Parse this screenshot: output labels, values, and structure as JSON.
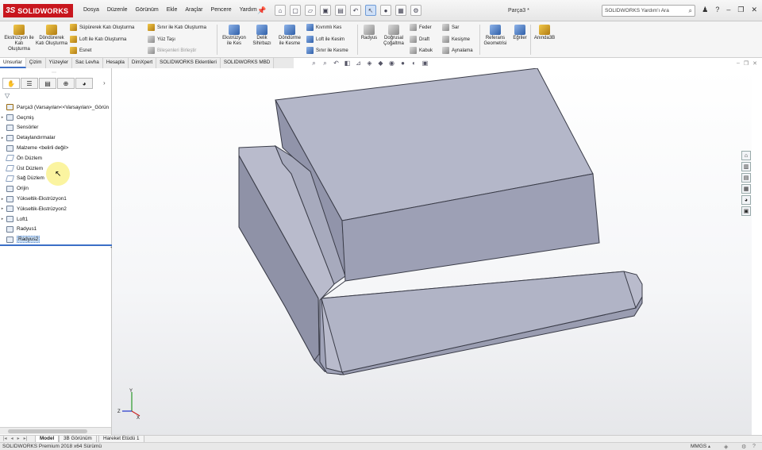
{
  "app": {
    "logo_mark": "3S",
    "logo_text": "SOLIDWORKS",
    "document_title": "Parça3 *"
  },
  "menu": [
    "Dosya",
    "Düzenle",
    "Görünüm",
    "Ekle",
    "Araçlar",
    "Pencere",
    "Yardım"
  ],
  "help_search": {
    "placeholder": "SOLIDWORKS Yardım'ı Ara"
  },
  "ribbon": {
    "extruded_boss": "Ekstrüzyon ile Katı Oluşturma",
    "revolved_boss": "Döndürerek Katı Oluşturma",
    "swept_boss": "Süpürerek Katı Oluşturma",
    "lofted_boss": "Loft ile Katı Oluşturma",
    "boundary_boss": "Sınır ile Katı Oluşturma",
    "thicken": "Esnet",
    "thicken2": "Yüz Taşı",
    "mirror_components": "Bileşenleri Birleştir",
    "extruded_cut": "Ekstrüzyon ile Kes",
    "hole_wizard": "Delik Sihirbazı",
    "revolved_cut": "Döndürme ile Kesme",
    "swept_cut": "Kıvrımlı Kes",
    "lofted_cut": "Loft ile Kesim",
    "boundary_cut": "Sınır ile Kesme",
    "fillet": "Radyus",
    "linear_pattern": "Doğrusal Çoğaltma",
    "rib": "Feder",
    "draft": "Draft",
    "shell": "Kabuk",
    "wrap": "Sar",
    "intersect": "Kesişme",
    "mirror": "Aynalama",
    "reference_geometry": "Referans Geometrisi",
    "curves": "Eğriler",
    "instant3d": "Anında3B"
  },
  "command_tabs": [
    "Unsurlar",
    "Çizim",
    "Yüzeyler",
    "Sac Levha",
    "Hesapla",
    "DimXpert",
    "SOLIDWORKS Eklentileri",
    "SOLIDWORKS MBD"
  ],
  "feature_tree": {
    "root": "Parça3  (Varsayılan<<Varsayılan>_Görün",
    "items": [
      "Geçmiş",
      "Sensörler",
      "Detaylandırmalar",
      "Malzeme <belirli değil>",
      "Ön Düzlem",
      "Üst Düzlem",
      "Sağ Düzlem",
      "Orijin",
      "Yükseltik-Ekstrüzyon1",
      "Yükseltik-Ekstrüzyon2",
      "Loft1",
      "Radyus1",
      "Radyus2"
    ]
  },
  "bottom_tabs": [
    "Model",
    "3B Görünüm",
    "Hareket Etüdü 1"
  ],
  "status": {
    "text": "SOLIDWORKS Premium 2018 x64 Sürümü",
    "units": "MMGS"
  },
  "triad": {
    "x": "X",
    "y": "Y",
    "z": "Z"
  },
  "colors": {
    "brand_red": "#c8161d",
    "model_top": "#b3b6c9",
    "model_side": "#8d90a6",
    "selection_blue": "#3b6fc7"
  }
}
